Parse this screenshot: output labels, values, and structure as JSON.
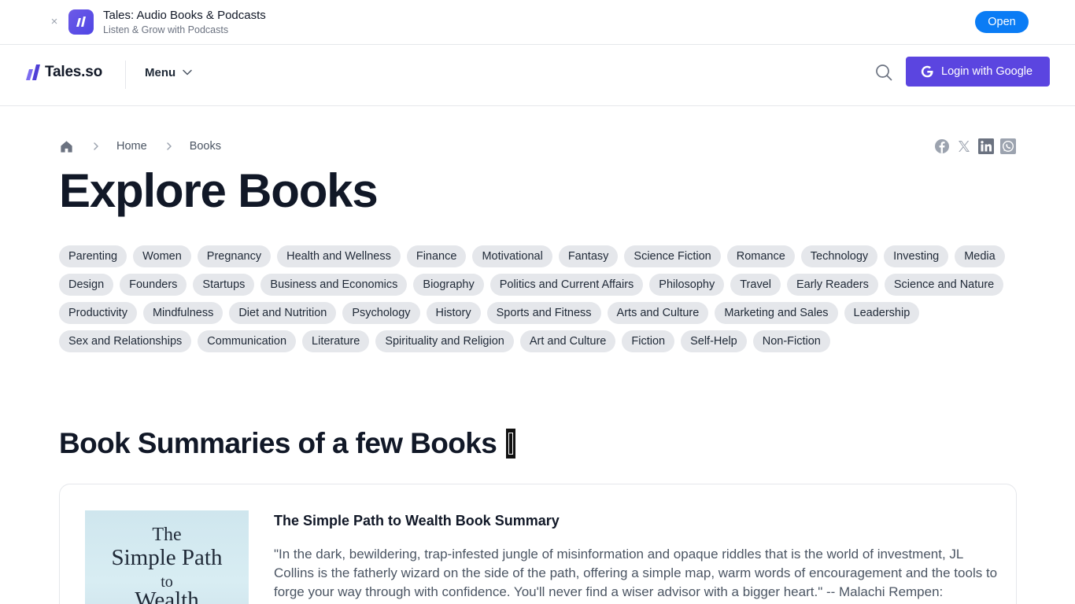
{
  "banner": {
    "close_glyph": "×",
    "app_icon": "tales-app-icon",
    "title": "Tales: Audio Books & Podcasts",
    "subtitle": "Listen & Grow with Podcasts",
    "open_label": "Open",
    "open_color": "#0a7cf5"
  },
  "header": {
    "logo_text": "Tales.so",
    "menu_label": "Menu",
    "search_icon": "search-icon",
    "login_label": "Login with Google",
    "login_color": "#5b45e0"
  },
  "breadcrumb": {
    "home_icon": "home-icon",
    "items": [
      "Home",
      "Books"
    ]
  },
  "share": {
    "icons": [
      "facebook-icon",
      "x-icon",
      "linkedin-icon",
      "whatsapp-icon"
    ]
  },
  "page_title": "Explore Books",
  "categories": [
    "Parenting",
    "Women",
    "Pregnancy",
    "Health and Wellness",
    "Finance",
    "Motivational",
    "Fantasy",
    "Science Fiction",
    "Romance",
    "Technology",
    "Investing",
    "Media",
    "Design",
    "Founders",
    "Startups",
    "Business and Economics",
    "Biography",
    "Politics and Current Affairs",
    "Philosophy",
    "Travel",
    "Early Readers",
    "Science and Nature",
    "Productivity",
    "Mindfulness",
    "Diet and Nutrition",
    "Psychology",
    "History",
    "Sports and Fitness",
    "Arts and Culture",
    "Marketing and Sales",
    "Leadership",
    "Sex and Relationships",
    "Communication",
    "Literature",
    "Spirituality and Religion",
    "Art and Culture",
    "Fiction",
    "Self-Help",
    "Non-Fiction"
  ],
  "section": {
    "title": "Book Summaries of a few Books"
  },
  "book": {
    "cover_lines": [
      "The",
      "Simple Path",
      "to",
      "Wealth"
    ],
    "title": "The Simple Path to Wealth Book Summary",
    "description": "\"In the dark, bewildering, trap-infested jungle of misinformation and opaque riddles that is the world of investment, JL Collins is the fatherly wizard on the side of the path, offering a simple map, warm words of encouragement and the tools to forge your way through with confidence. You'll never find a wiser advisor with a bigger heart.\" -- Malachi Rempen:"
  }
}
